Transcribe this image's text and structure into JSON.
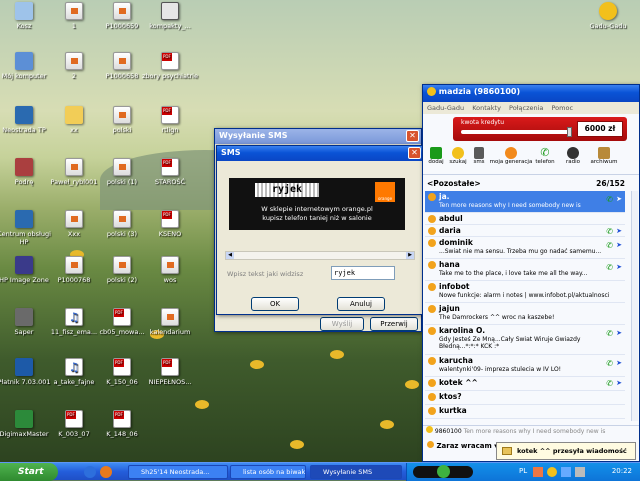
{
  "desktop_icons": [
    {
      "label": "Kosz",
      "icon": "recycle-bin-icon"
    },
    {
      "label": "1",
      "icon": "document-icon"
    },
    {
      "label": "P1000659",
      "icon": "image-file-icon"
    },
    {
      "label": "kompakty_...",
      "icon": "floppy-icon"
    },
    {
      "label": "Mój komputer",
      "icon": "computer-icon"
    },
    {
      "label": "2",
      "icon": "document-icon"
    },
    {
      "label": "P1000658",
      "icon": "image-file-icon"
    },
    {
      "label": "zbory psychiatrie",
      "icon": "pdf-icon"
    },
    {
      "label": "Neostrada TP",
      "icon": "app-icon"
    },
    {
      "label": "xx",
      "icon": "folder-icon"
    },
    {
      "label": "polski",
      "icon": "document-icon"
    },
    {
      "label": "rtlign",
      "icon": "pdf-icon"
    },
    {
      "label": "Podrę",
      "icon": "app-icon"
    },
    {
      "label": "Paweł_rybl001",
      "icon": "document-icon"
    },
    {
      "label": "polski (1)",
      "icon": "document-icon"
    },
    {
      "label": "STAROŚĆ",
      "icon": "pdf-icon"
    },
    {
      "label": "Centrum obsługi HP",
      "icon": "app-icon"
    },
    {
      "label": "Xxx",
      "icon": "document-icon"
    },
    {
      "label": "polski (3)",
      "icon": "document-icon"
    },
    {
      "label": "KSENO",
      "icon": "pdf-icon"
    },
    {
      "label": "HP Image Zone",
      "icon": "app-icon"
    },
    {
      "label": "P1000768",
      "icon": "image-file-icon"
    },
    {
      "label": "polski (2)",
      "icon": "document-icon"
    },
    {
      "label": "wos",
      "icon": "document-icon"
    },
    {
      "label": "Saper",
      "icon": "app-icon"
    },
    {
      "label": "11_fisz_ema...",
      "icon": "mp3-icon"
    },
    {
      "label": "cb05_mowa...",
      "icon": "pdf-icon"
    },
    {
      "label": "kalendarium",
      "icon": "document-icon"
    },
    {
      "label": "Płatnik 7.03.001",
      "icon": "app-icon"
    },
    {
      "label": "a_take_fajne",
      "icon": "mp3-icon"
    },
    {
      "label": "K_150_06",
      "icon": "pdf-icon"
    },
    {
      "label": "NIEPEŁNOS...",
      "icon": "pdf-icon"
    },
    {
      "label": "DigimaxMaster",
      "icon": "app-icon"
    },
    {
      "label": "K_003_07",
      "icon": "pdf-icon"
    },
    {
      "label": "K_148_06",
      "icon": "pdf-icon"
    },
    {
      "label": "Gadu-Gadu",
      "icon": "gadu-gadu-icon"
    }
  ],
  "sms_back": {
    "title": "Wysyłanie SMS",
    "send": "Wyślij",
    "close": "Przerwij"
  },
  "sms_dialog": {
    "title": "SMS",
    "captcha_text": "ryjek",
    "orange_logo": "orange",
    "ad_line1": "W sklepie internetowym orange.pl",
    "ad_line2": "kupisz telefon taniej niż w salonie",
    "prompt": "Wpisz tekst jaki widzisz",
    "input_value": "ryjek",
    "ok": "OK",
    "cancel": "Anuluj"
  },
  "gg": {
    "title": "madzia (9860100)",
    "menu": [
      "Gadu-Gadu",
      "Kontakty",
      "Połączenia",
      "Pomoc"
    ],
    "credit_label": "kwota kredytu",
    "credit_value": "6000 zł",
    "toolbar": [
      "dodaj",
      "szukaj",
      "sms",
      "moja generacja",
      "telefon",
      "radio",
      "archiwum"
    ],
    "group": "<Pozostałe>",
    "group_count": "26/152",
    "contacts": [
      {
        "name": "ja.",
        "status": "Ten more reasons why I need somebody new is"
      },
      {
        "name": "abdul",
        "status": ""
      },
      {
        "name": "daria",
        "status": ""
      },
      {
        "name": "dominik",
        "status": "...Świat nie ma sensu. Trzeba mu go nadać samemu..."
      },
      {
        "name": "hana",
        "status": "Take me to the place, i love take me all the way..."
      },
      {
        "name": "infobot",
        "status": "Nowe funkcje: alarm i notes | www.infobot.pl/aktualnosci"
      },
      {
        "name": "jajun",
        "status": "The Damrockers ^^ wroc na kaszebe!"
      },
      {
        "name": "karolina O.",
        "status": "Gdy Jesteś Ze Mną...Cały Świat Wiruje Gwiazdy Błedną...*:*:* KCK :*"
      },
      {
        "name": "karucha",
        "status": "walentynki'09- impreza stulecia w IV LO!"
      },
      {
        "name": "kotek ^^",
        "status": ""
      },
      {
        "name": "ktos?",
        "status": ""
      },
      {
        "name": "kurtka",
        "status": ""
      }
    ],
    "footer_number": "9860100",
    "footer_status": "Ten more reasons why I need somebody new is",
    "away_label": "Zaraz wracam"
  },
  "taskbar": {
    "start": "Start",
    "buttons": [
      "Sh25'14 Neostrada...",
      "lista osób na biwak...",
      "Wysyłanie SMS"
    ],
    "notification": "kotek ^^ przesyła wiadomość",
    "lang": "PL",
    "clock": "20:22"
  }
}
